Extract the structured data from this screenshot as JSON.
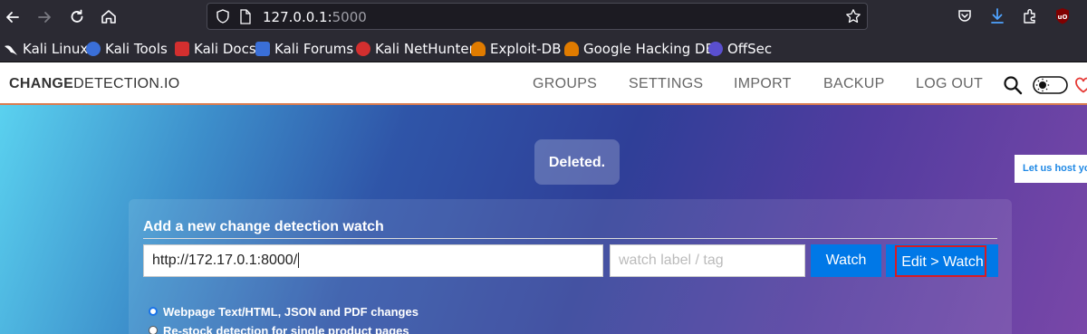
{
  "browser": {
    "url_host": "127.0.0.1:",
    "url_port": "5000",
    "bookmarks": [
      {
        "label": "Kali Linux",
        "color": "#2c2c2c"
      },
      {
        "label": "Kali Tools",
        "color": "#3a6fd8"
      },
      {
        "label": "Kali Docs",
        "color": "#d32f2f"
      },
      {
        "label": "Kali Forums",
        "color": "#3a6fd8"
      },
      {
        "label": "Kali NetHunter",
        "color": "#d32f2f"
      },
      {
        "label": "Exploit-DB",
        "color": "#e07b00"
      },
      {
        "label": "Google Hacking DB",
        "color": "#e07b00"
      },
      {
        "label": "OffSec",
        "color": "#5a4fcf"
      }
    ]
  },
  "header": {
    "brand_bold": "CHANGE",
    "brand_rest": "DETECTION.IO",
    "menu": [
      "GROUPS",
      "SETTINGS",
      "IMPORT",
      "BACKUP",
      "LOG OUT"
    ]
  },
  "flash_message": "Deleted.",
  "side_banner": "Let us host yo",
  "watch_form": {
    "title": "Add a new change detection watch",
    "url_value": "http://172.17.0.1:8000/",
    "tag_placeholder": "watch label / tag",
    "watch_button": "Watch",
    "edit_watch_button": "Edit > Watch",
    "options": [
      {
        "label": "Webpage Text/HTML, JSON and PDF changes",
        "checked": true
      },
      {
        "label": "Re-stock detection for single product pages",
        "checked": false
      }
    ]
  },
  "colors": {
    "accent_button": "#0078e7",
    "header_border": "#d97c50",
    "highlight_outline": "#d81b23"
  }
}
